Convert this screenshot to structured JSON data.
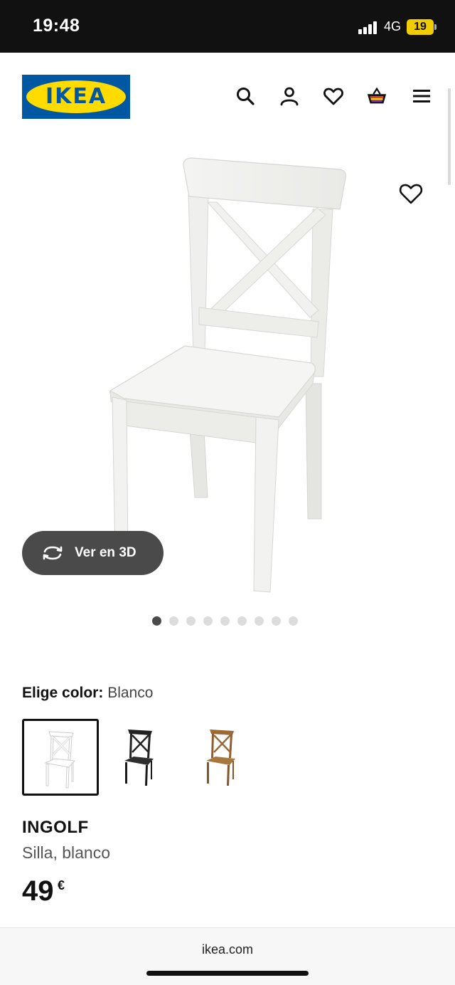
{
  "status_bar": {
    "time": "19:48",
    "network": "4G",
    "battery": "19"
  },
  "header": {
    "logo_text": "IKEA",
    "icons": [
      "search-icon",
      "account-icon",
      "heart-icon",
      "basket-icon",
      "menu-icon"
    ]
  },
  "gallery": {
    "view_3d_label": "Ver en 3D",
    "dot_count": 9,
    "active_dot": 1
  },
  "color_selector": {
    "label": "Elige color:",
    "selected_value": "Blanco",
    "swatches": [
      {
        "color": "#ffffff",
        "selected": true
      },
      {
        "color": "#222222",
        "selected": false
      },
      {
        "color": "#9a6a35",
        "selected": false
      }
    ]
  },
  "product": {
    "name": "INGOLF",
    "description": "Silla, blanco",
    "price": "49",
    "currency": "€"
  },
  "browser": {
    "url": "ikea.com"
  },
  "colors": {
    "ikea_blue": "#0058a3",
    "ikea_yellow": "#ffdb00",
    "basket_accent": "#7b2fb5"
  }
}
